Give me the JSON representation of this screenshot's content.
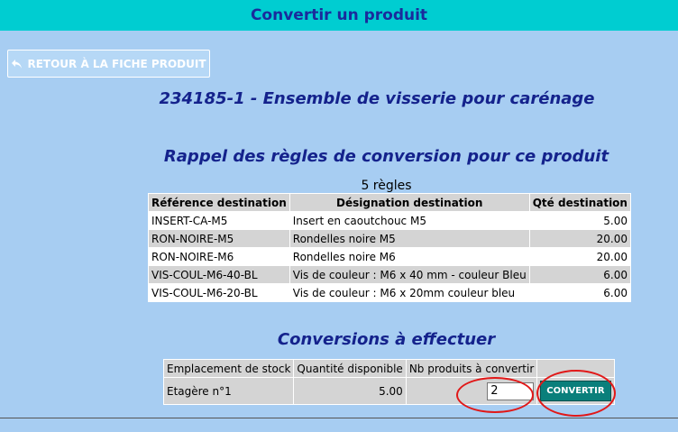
{
  "header": {
    "title": "Convertir un produit"
  },
  "back_button": {
    "label": "RETOUR À LA FICHE PRODUIT",
    "icon": "reply-arrow-icon"
  },
  "product": {
    "title": "234185-1 - Ensemble de visserie pour carénage"
  },
  "rules": {
    "section_title": "Rappel des règles de conversion pour ce produit",
    "count": "5 règles",
    "columns": [
      "Référence destination",
      "Désignation destination",
      "Qté destination"
    ],
    "rows": [
      [
        "INSERT-CA-M5",
        "Insert en caoutchouc M5",
        "5.00"
      ],
      [
        "RON-NOIRE-M5",
        "Rondelles noire M5",
        "20.00"
      ],
      [
        "RON-NOIRE-M6",
        "Rondelles noire M6",
        "20.00"
      ],
      [
        "VIS-COUL-M6-40-BL",
        "Vis de couleur : M6 x 40 mm - couleur Bleu",
        "6.00"
      ],
      [
        "VIS-COUL-M6-20-BL",
        "Vis de couleur : M6 x 20mm couleur bleu",
        "6.00"
      ]
    ]
  },
  "conversions": {
    "section_title": "Conversions à effectuer",
    "columns": [
      "Emplacement de stock",
      "Quantité disponible",
      "Nb produits à convertir"
    ],
    "row": {
      "location": "Etagère n°1",
      "available": "5.00",
      "quantity_value": "2",
      "convert_label": "CONVERTIR"
    }
  },
  "colors": {
    "background": "#a7cdf2",
    "header_bar": "#00cdd1",
    "title_text": "#14228c",
    "convert_button": "#0a7f7b",
    "annotation": "#e11818"
  }
}
